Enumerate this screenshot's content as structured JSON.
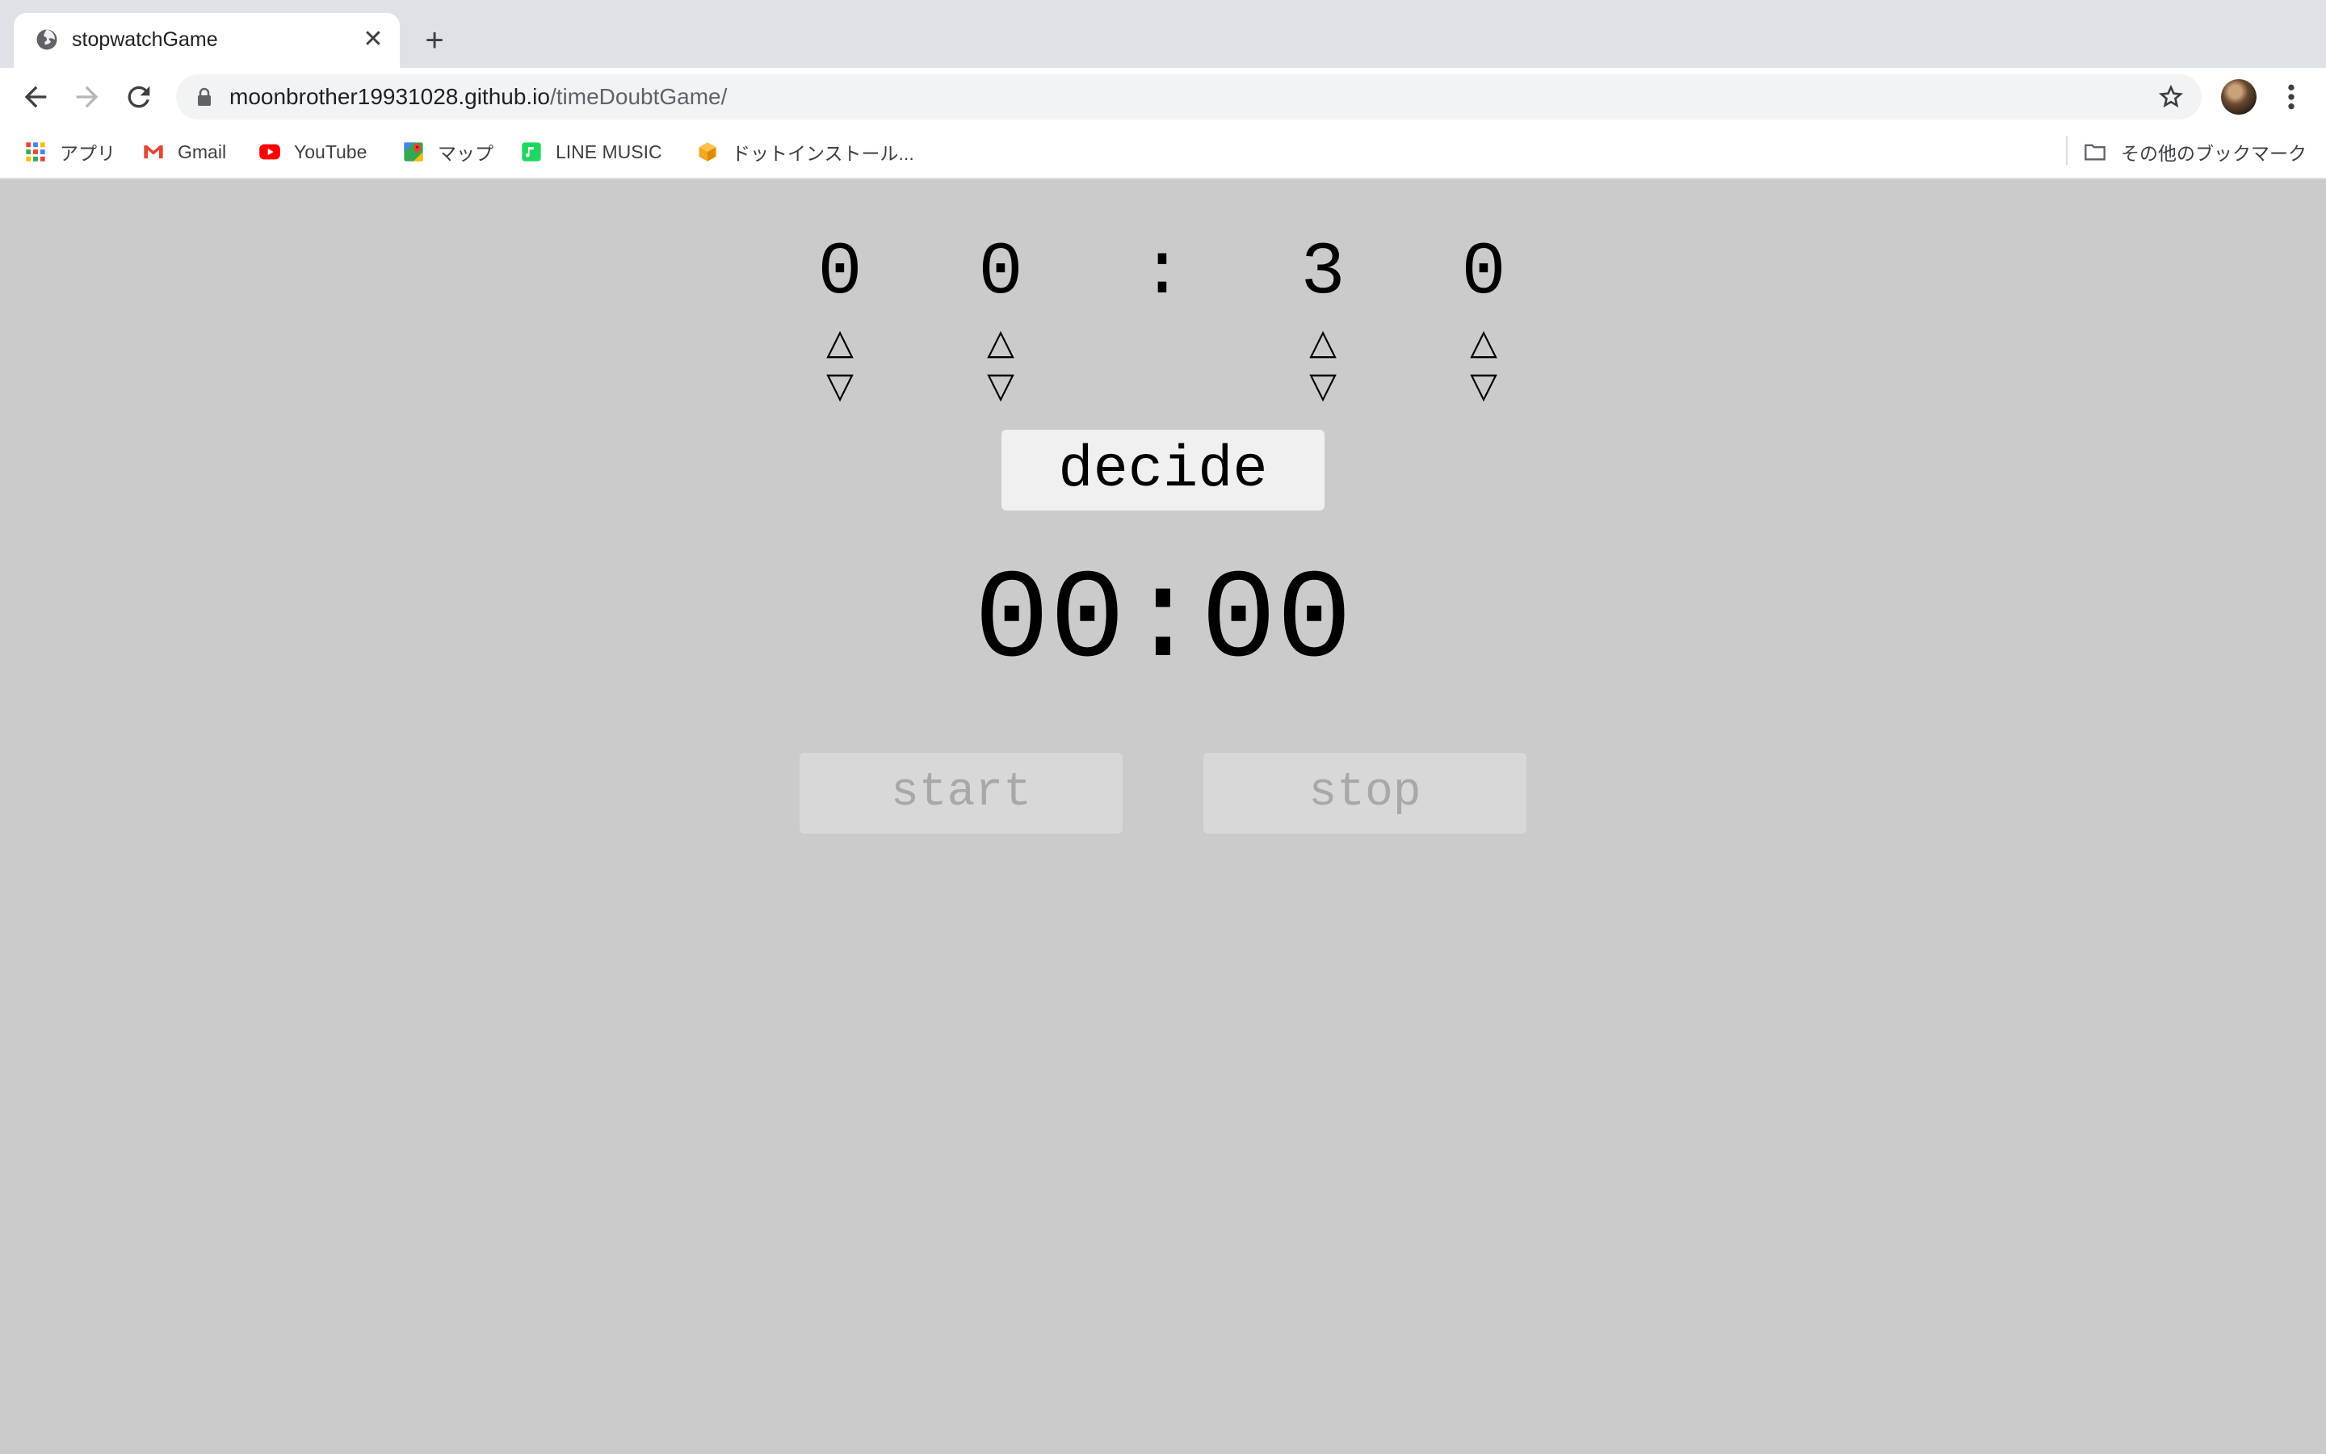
{
  "browser": {
    "tab_title": "stopwatchGame",
    "tab_close": "✕",
    "new_tab": "+",
    "url_host": "moonbrother19931028.github.io",
    "url_path": "/timeDoubtGame/"
  },
  "bookmarks": [
    {
      "label": "アプリ",
      "icon": "apps-grid-icon"
    },
    {
      "label": "Gmail",
      "icon": "gmail-icon"
    },
    {
      "label": "YouTube",
      "icon": "youtube-icon"
    },
    {
      "label": "マップ",
      "icon": "maps-icon"
    },
    {
      "label": "LINE MUSIC",
      "icon": "line-music-icon"
    },
    {
      "label": "ドットインストール...",
      "icon": "dotinstall-icon"
    }
  ],
  "other_bookmarks": "その他のブックマーク",
  "setter": {
    "d1": "0",
    "d2": "0",
    "colon": ":",
    "d3": "3",
    "d4": "0",
    "up": "△",
    "down": "▽"
  },
  "decide_label": "decide",
  "timer_display": "00:00",
  "start_label": "start",
  "stop_label": "stop",
  "colors": {
    "page_bg": "#cbcbcb",
    "button_bg": "#f0f0f0",
    "disabled_button_bg": "#d8d8d8",
    "disabled_text": "#a8a8a8"
  }
}
